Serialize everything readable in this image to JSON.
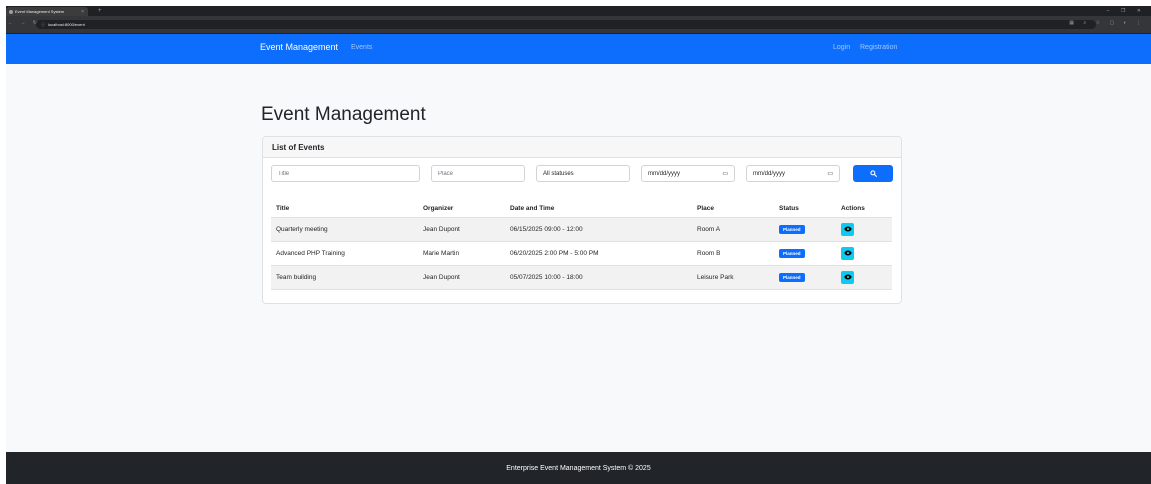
{
  "browser": {
    "tab_title": "Event Management System",
    "tab_close": "×",
    "new_tab": "+",
    "window_controls": "–  ❐  ✕",
    "nav_buttons": "←  →  ↻",
    "url_lock": "ⓘ",
    "url": "localhost:8000/event",
    "extension_icons": "▦ ⌕ ☆ ▢ ◐ ⋮"
  },
  "navbar": {
    "brand": "Event Management",
    "events_link": "Events",
    "login_link": "Login",
    "registration_link": "Registration",
    "color": "#0d6efd"
  },
  "page": {
    "heading": "Event Management"
  },
  "card": {
    "header": "List of Events",
    "filters": {
      "title_placeholder": "Title",
      "place_placeholder": "Place",
      "status_value": "All statuses",
      "date_from_placeholder": "mm/dd/yyyy",
      "date_to_placeholder": "mm/dd/yyyy",
      "calendar_icon": "▭",
      "search_icon": "search-icon"
    },
    "table": {
      "headers": [
        "Title",
        "Organizer",
        "Date and Time",
        "Place",
        "Status",
        "Actions"
      ],
      "rows": [
        {
          "title": "Quarterly meeting",
          "organizer": "Jean Dupont",
          "datetime": "06/15/2025 09:00 - 12:00",
          "place": "Room A",
          "status": "Planned"
        },
        {
          "title": "Advanced PHP Training",
          "organizer": "Marie Martin",
          "datetime": "06/20/2025 2:00 PM - 5:00 PM",
          "place": "Room B",
          "status": "Planned"
        },
        {
          "title": "Team building",
          "organizer": "Jean Dupont",
          "datetime": "05/07/2025 10:00 - 18:00",
          "place": "Leisure Park",
          "status": "Planned"
        }
      ]
    }
  },
  "footer": {
    "text": "Enterprise Event Management System © 2025"
  }
}
